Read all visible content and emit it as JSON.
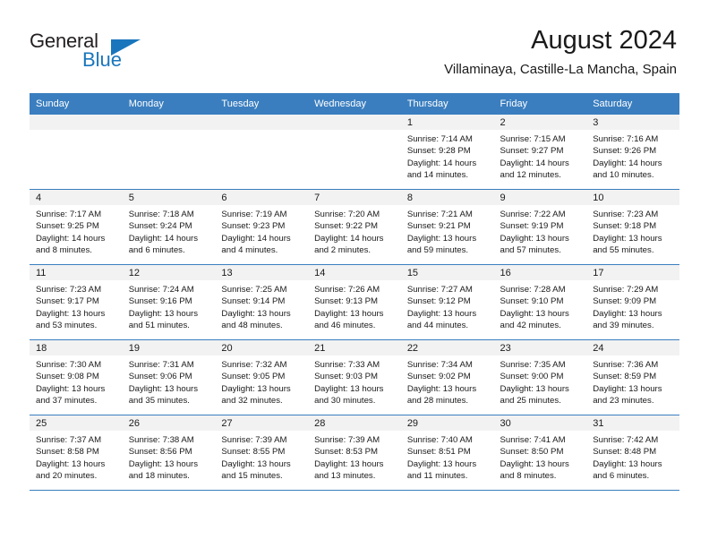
{
  "brand": {
    "name_part1": "General",
    "name_part2": "Blue",
    "logo_icon": "triangle-icon"
  },
  "header": {
    "title": "August 2024",
    "subtitle": "Villaminaya, Castille-La Mancha, Spain"
  },
  "colors": {
    "header_blue": "#3a7ebf",
    "brand_blue": "#1a76bc",
    "daynum_strip": "#f2f2f2",
    "text": "#1a1a1a"
  },
  "weekday_headers": [
    "Sunday",
    "Monday",
    "Tuesday",
    "Wednesday",
    "Thursday",
    "Friday",
    "Saturday"
  ],
  "weeks": [
    [
      {
        "day": "",
        "empty": true
      },
      {
        "day": "",
        "empty": true
      },
      {
        "day": "",
        "empty": true
      },
      {
        "day": "",
        "empty": true
      },
      {
        "day": "1",
        "sunrise": "Sunrise: 7:14 AM",
        "sunset": "Sunset: 9:28 PM",
        "daylight_line1": "Daylight: 14 hours",
        "daylight_line2": "and 14 minutes."
      },
      {
        "day": "2",
        "sunrise": "Sunrise: 7:15 AM",
        "sunset": "Sunset: 9:27 PM",
        "daylight_line1": "Daylight: 14 hours",
        "daylight_line2": "and 12 minutes."
      },
      {
        "day": "3",
        "sunrise": "Sunrise: 7:16 AM",
        "sunset": "Sunset: 9:26 PM",
        "daylight_line1": "Daylight: 14 hours",
        "daylight_line2": "and 10 minutes."
      }
    ],
    [
      {
        "day": "4",
        "sunrise": "Sunrise: 7:17 AM",
        "sunset": "Sunset: 9:25 PM",
        "daylight_line1": "Daylight: 14 hours",
        "daylight_line2": "and 8 minutes."
      },
      {
        "day": "5",
        "sunrise": "Sunrise: 7:18 AM",
        "sunset": "Sunset: 9:24 PM",
        "daylight_line1": "Daylight: 14 hours",
        "daylight_line2": "and 6 minutes."
      },
      {
        "day": "6",
        "sunrise": "Sunrise: 7:19 AM",
        "sunset": "Sunset: 9:23 PM",
        "daylight_line1": "Daylight: 14 hours",
        "daylight_line2": "and 4 minutes."
      },
      {
        "day": "7",
        "sunrise": "Sunrise: 7:20 AM",
        "sunset": "Sunset: 9:22 PM",
        "daylight_line1": "Daylight: 14 hours",
        "daylight_line2": "and 2 minutes."
      },
      {
        "day": "8",
        "sunrise": "Sunrise: 7:21 AM",
        "sunset": "Sunset: 9:21 PM",
        "daylight_line1": "Daylight: 13 hours",
        "daylight_line2": "and 59 minutes."
      },
      {
        "day": "9",
        "sunrise": "Sunrise: 7:22 AM",
        "sunset": "Sunset: 9:19 PM",
        "daylight_line1": "Daylight: 13 hours",
        "daylight_line2": "and 57 minutes."
      },
      {
        "day": "10",
        "sunrise": "Sunrise: 7:23 AM",
        "sunset": "Sunset: 9:18 PM",
        "daylight_line1": "Daylight: 13 hours",
        "daylight_line2": "and 55 minutes."
      }
    ],
    [
      {
        "day": "11",
        "sunrise": "Sunrise: 7:23 AM",
        "sunset": "Sunset: 9:17 PM",
        "daylight_line1": "Daylight: 13 hours",
        "daylight_line2": "and 53 minutes."
      },
      {
        "day": "12",
        "sunrise": "Sunrise: 7:24 AM",
        "sunset": "Sunset: 9:16 PM",
        "daylight_line1": "Daylight: 13 hours",
        "daylight_line2": "and 51 minutes."
      },
      {
        "day": "13",
        "sunrise": "Sunrise: 7:25 AM",
        "sunset": "Sunset: 9:14 PM",
        "daylight_line1": "Daylight: 13 hours",
        "daylight_line2": "and 48 minutes."
      },
      {
        "day": "14",
        "sunrise": "Sunrise: 7:26 AM",
        "sunset": "Sunset: 9:13 PM",
        "daylight_line1": "Daylight: 13 hours",
        "daylight_line2": "and 46 minutes."
      },
      {
        "day": "15",
        "sunrise": "Sunrise: 7:27 AM",
        "sunset": "Sunset: 9:12 PM",
        "daylight_line1": "Daylight: 13 hours",
        "daylight_line2": "and 44 minutes."
      },
      {
        "day": "16",
        "sunrise": "Sunrise: 7:28 AM",
        "sunset": "Sunset: 9:10 PM",
        "daylight_line1": "Daylight: 13 hours",
        "daylight_line2": "and 42 minutes."
      },
      {
        "day": "17",
        "sunrise": "Sunrise: 7:29 AM",
        "sunset": "Sunset: 9:09 PM",
        "daylight_line1": "Daylight: 13 hours",
        "daylight_line2": "and 39 minutes."
      }
    ],
    [
      {
        "day": "18",
        "sunrise": "Sunrise: 7:30 AM",
        "sunset": "Sunset: 9:08 PM",
        "daylight_line1": "Daylight: 13 hours",
        "daylight_line2": "and 37 minutes."
      },
      {
        "day": "19",
        "sunrise": "Sunrise: 7:31 AM",
        "sunset": "Sunset: 9:06 PM",
        "daylight_line1": "Daylight: 13 hours",
        "daylight_line2": "and 35 minutes."
      },
      {
        "day": "20",
        "sunrise": "Sunrise: 7:32 AM",
        "sunset": "Sunset: 9:05 PM",
        "daylight_line1": "Daylight: 13 hours",
        "daylight_line2": "and 32 minutes."
      },
      {
        "day": "21",
        "sunrise": "Sunrise: 7:33 AM",
        "sunset": "Sunset: 9:03 PM",
        "daylight_line1": "Daylight: 13 hours",
        "daylight_line2": "and 30 minutes."
      },
      {
        "day": "22",
        "sunrise": "Sunrise: 7:34 AM",
        "sunset": "Sunset: 9:02 PM",
        "daylight_line1": "Daylight: 13 hours",
        "daylight_line2": "and 28 minutes."
      },
      {
        "day": "23",
        "sunrise": "Sunrise: 7:35 AM",
        "sunset": "Sunset: 9:00 PM",
        "daylight_line1": "Daylight: 13 hours",
        "daylight_line2": "and 25 minutes."
      },
      {
        "day": "24",
        "sunrise": "Sunrise: 7:36 AM",
        "sunset": "Sunset: 8:59 PM",
        "daylight_line1": "Daylight: 13 hours",
        "daylight_line2": "and 23 minutes."
      }
    ],
    [
      {
        "day": "25",
        "sunrise": "Sunrise: 7:37 AM",
        "sunset": "Sunset: 8:58 PM",
        "daylight_line1": "Daylight: 13 hours",
        "daylight_line2": "and 20 minutes."
      },
      {
        "day": "26",
        "sunrise": "Sunrise: 7:38 AM",
        "sunset": "Sunset: 8:56 PM",
        "daylight_line1": "Daylight: 13 hours",
        "daylight_line2": "and 18 minutes."
      },
      {
        "day": "27",
        "sunrise": "Sunrise: 7:39 AM",
        "sunset": "Sunset: 8:55 PM",
        "daylight_line1": "Daylight: 13 hours",
        "daylight_line2": "and 15 minutes."
      },
      {
        "day": "28",
        "sunrise": "Sunrise: 7:39 AM",
        "sunset": "Sunset: 8:53 PM",
        "daylight_line1": "Daylight: 13 hours",
        "daylight_line2": "and 13 minutes."
      },
      {
        "day": "29",
        "sunrise": "Sunrise: 7:40 AM",
        "sunset": "Sunset: 8:51 PM",
        "daylight_line1": "Daylight: 13 hours",
        "daylight_line2": "and 11 minutes."
      },
      {
        "day": "30",
        "sunrise": "Sunrise: 7:41 AM",
        "sunset": "Sunset: 8:50 PM",
        "daylight_line1": "Daylight: 13 hours",
        "daylight_line2": "and 8 minutes."
      },
      {
        "day": "31",
        "sunrise": "Sunrise: 7:42 AM",
        "sunset": "Sunset: 8:48 PM",
        "daylight_line1": "Daylight: 13 hours",
        "daylight_line2": "and 6 minutes."
      }
    ]
  ]
}
